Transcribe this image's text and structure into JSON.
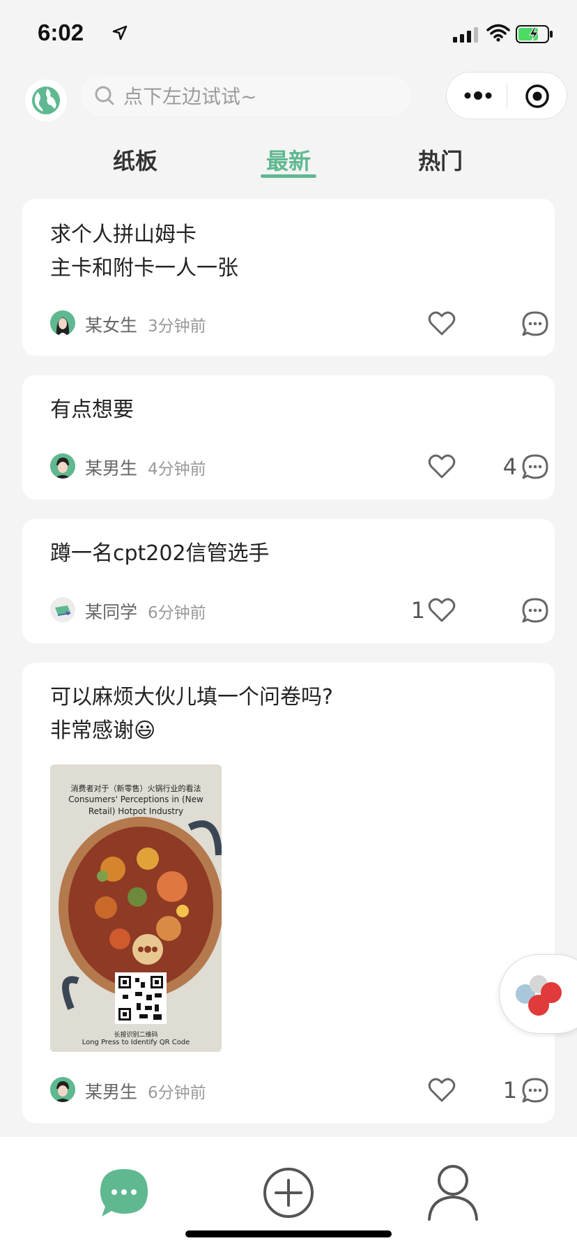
{
  "status": {
    "time": "6:02"
  },
  "search": {
    "placeholder": "点下左边试试~"
  },
  "tabs": [
    {
      "label": "纸板"
    },
    {
      "label": "最新",
      "active": true
    },
    {
      "label": "热门"
    }
  ],
  "colors": {
    "accent": "#5fb890",
    "background": "#f4f4f4"
  },
  "posts": [
    {
      "lines": [
        "求个人拼山姆卡",
        "主卡和附卡一人一张"
      ],
      "author": "某女生",
      "time": "3分钟前",
      "likes": "",
      "comments": ""
    },
    {
      "lines": [
        "有点想要"
      ],
      "author": "某男生",
      "time": "4分钟前",
      "likes": "",
      "comments": "4"
    },
    {
      "lines": [
        "蹲一名cpt202信管选手"
      ],
      "author": "某同学",
      "time": "6分钟前",
      "likes": "1",
      "comments": ""
    },
    {
      "lines": [
        "可以麻烦大伙儿填一个问卷吗?",
        "非常感谢😃"
      ],
      "author": "某男生",
      "time": "6分钟前",
      "likes": "",
      "comments": "1",
      "image": {
        "title_cn": "消费者对于（新零售）火锅行业的看法",
        "title_en": "Consumers' Perceptions in (New Retail) Hotpot Industry",
        "hint_cn": "长按识别二维码",
        "hint_en": "Long Press to Identify QR Code"
      }
    }
  ],
  "icons": {
    "location": "location-arrow-icon",
    "globe": "globe-icon",
    "search": "search-icon",
    "more": "more-dots-icon",
    "close": "target-close-icon",
    "heart": "heart-icon",
    "comment": "comment-bubble-icon",
    "chat_tab": "chat-icon",
    "add_tab": "add-icon",
    "profile_tab": "profile-icon"
  }
}
